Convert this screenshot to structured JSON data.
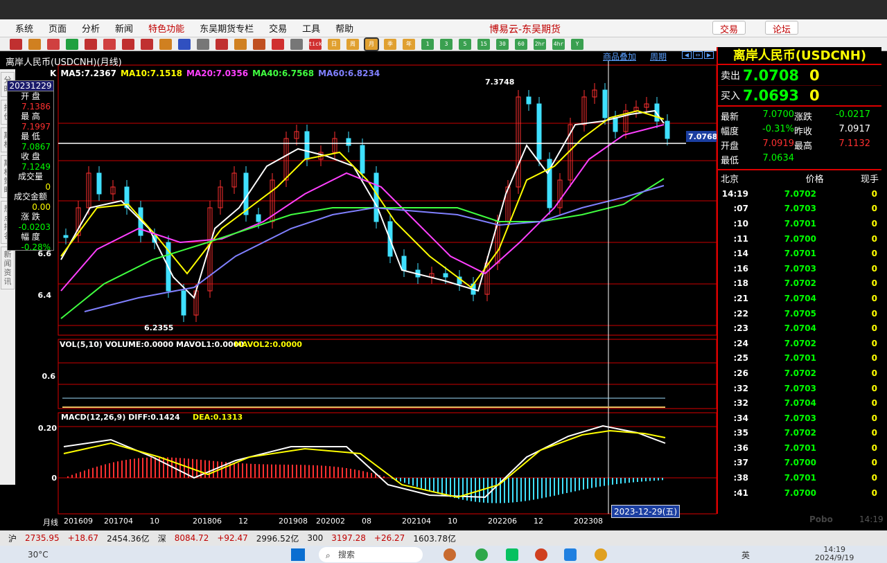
{
  "window": {
    "title": "博易云-东吴期货",
    "trade_button": "交易",
    "forum_button": "论坛"
  },
  "menu": [
    "系统",
    "页面",
    "分析",
    "新闻",
    "特色功能",
    "东吴期货专栏",
    "交易",
    "工具",
    "帮助"
  ],
  "toolbar": {
    "buttons": [
      "tick",
      "日",
      "周",
      "月",
      "季",
      "年",
      "1",
      "3",
      "5",
      "15",
      "30",
      "60",
      "2hr",
      "4hr",
      "Y"
    ]
  },
  "chart": {
    "title": "离岸人民币(USDCNH)(月线)",
    "link_products": "商品叠加",
    "link_period": "周期",
    "k_label": "K",
    "ma_legend": [
      {
        "text": "MA5:7.2367",
        "color": "#ffffff"
      },
      {
        "text": "MA10:7.1518",
        "color": "#ffff00"
      },
      {
        "text": "MA20:7.0356",
        "color": "#ff40ff"
      },
      {
        "text": "MA40:6.7568",
        "color": "#40ff40"
      },
      {
        "text": "MA60:6.8234",
        "color": "#8080ff"
      }
    ],
    "y_labels": [
      "6.6",
      "6.4"
    ],
    "high_label": "7.3748",
    "low_label": "6.2355",
    "price_tag": "7.0768",
    "vol_legend": {
      "main": "VOL(5,10) VOLUME:0.0000 MAVOL1:0.0000",
      "mavol2": "MAVOL2:0.0000"
    },
    "vol_y_label": "0.6",
    "macd_legend": {
      "main": "MACD(12,26,9) DIFF:0.1424",
      "dea": "DEA:0.1313"
    },
    "macd_y_labels": [
      "0.20",
      "0"
    ],
    "x_labels": [
      "月线",
      "201609",
      "201704",
      "10",
      "201806",
      "12",
      "201908",
      "202002",
      "08",
      "202104",
      "10",
      "202206",
      "12",
      "202308"
    ],
    "cursor_date": "2023-12-29(五)"
  },
  "info_panel": {
    "date": "20231229",
    "open_label": "开 盘",
    "open": "7.1386",
    "high_label": "最 高",
    "high": "7.1997",
    "low_label": "最 低",
    "low": "7.0867",
    "close_label": "收 盘",
    "close": "7.1249",
    "volume_label": "成交量",
    "volume": "0",
    "amount_label": "成交金额",
    "amount": "0.00",
    "change_label": "涨 跌",
    "change": "-0.0203",
    "pct_label": "幅 度",
    "pct": "-0.28%"
  },
  "sidebar_tabs": [
    "分时",
    "报价",
    "期权",
    "期权策略",
    "热点排名",
    "新闻资讯"
  ],
  "quote": {
    "title": "离岸人民币(USDCNH)",
    "sell_label": "卖出",
    "sell_price": "7.0708",
    "sell_vol": "0",
    "buy_label": "买入",
    "buy_price": "7.0693",
    "buy_vol": "0",
    "grid": [
      {
        "l1": "最新",
        "v1": "7.0700",
        "c1": "#00ff00",
        "l2": "涨跌",
        "v2": "-0.0217",
        "c2": "#00ff00"
      },
      {
        "l1": "幅度",
        "v1": "-0.31%",
        "c1": "#00ff00",
        "l2": "昨收",
        "v2": "7.0917",
        "c2": "#ffffff"
      },
      {
        "l1": "开盘",
        "v1": "7.0919",
        "c1": "#ff3030",
        "l2": "最高",
        "v2": "7.1132",
        "c2": "#ff3030"
      },
      {
        "l1": "最低",
        "v1": "7.0634",
        "c1": "#00ff00",
        "l2": "",
        "v2": "",
        "c2": "#ffffff"
      }
    ],
    "tick_headers": [
      "北京",
      "价格",
      "现手"
    ],
    "ticks": [
      {
        "time": "14:19",
        "price": "7.0702",
        "vol": "0"
      },
      {
        "time": ":07",
        "price": "7.0703",
        "vol": "0"
      },
      {
        "time": ":10",
        "price": "7.0701",
        "vol": "0"
      },
      {
        "time": ":11",
        "price": "7.0700",
        "vol": "0"
      },
      {
        "time": ":14",
        "price": "7.0701",
        "vol": "0"
      },
      {
        "time": ":16",
        "price": "7.0703",
        "vol": "0"
      },
      {
        "time": ":18",
        "price": "7.0702",
        "vol": "0"
      },
      {
        "time": ":21",
        "price": "7.0704",
        "vol": "0"
      },
      {
        "time": ":22",
        "price": "7.0705",
        "vol": "0"
      },
      {
        "time": ":23",
        "price": "7.0704",
        "vol": "0"
      },
      {
        "time": ":24",
        "price": "7.0702",
        "vol": "0"
      },
      {
        "time": ":25",
        "price": "7.0701",
        "vol": "0"
      },
      {
        "time": ":26",
        "price": "7.0702",
        "vol": "0"
      },
      {
        "time": ":32",
        "price": "7.0703",
        "vol": "0"
      },
      {
        "time": ":32",
        "price": "7.0704",
        "vol": "0"
      },
      {
        "time": ":34",
        "price": "7.0703",
        "vol": "0"
      },
      {
        "time": ":35",
        "price": "7.0702",
        "vol": "0"
      },
      {
        "time": ":36",
        "price": "7.0701",
        "vol": "0"
      },
      {
        "time": ":37",
        "price": "7.0700",
        "vol": "0"
      },
      {
        "time": ":38",
        "price": "7.0701",
        "vol": "0"
      },
      {
        "time": ":41",
        "price": "7.0700",
        "vol": "0"
      }
    ]
  },
  "status": {
    "sh_label": "沪",
    "sh_index": "2735.95",
    "sh_change": "+18.67",
    "sh_amount": "2454.36亿",
    "sz_label": "深",
    "sz_index": "8084.72",
    "sz_change": "+92.47",
    "sz_amount": "2996.52亿",
    "c300_label": "300",
    "c300_index": "3197.28",
    "c300_change": "+26.27",
    "c300_amount": "1603.78亿",
    "brand": "Pobo",
    "time": "14:19"
  },
  "taskbar": {
    "weather": "30°C",
    "search_placeholder": "搜索",
    "ime": "英",
    "clock_time": "14:19",
    "clock_date": "2024/9/19"
  }
}
